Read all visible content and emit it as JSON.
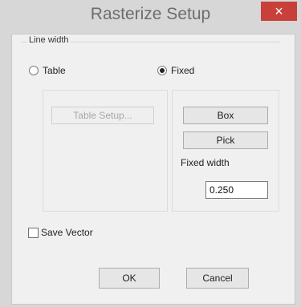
{
  "window": {
    "title": "Rasterize Setup",
    "close_glyph": "×"
  },
  "line_width": {
    "legend": "Line width",
    "options": [
      {
        "label": "Table",
        "checked": false
      },
      {
        "label": "Fixed",
        "checked": true
      }
    ]
  },
  "table_panel": {
    "table_setup_label": "Table Setup..."
  },
  "fixed_panel": {
    "box_label": "Box",
    "pick_label": "Pick",
    "fixed_width_label": "Fixed width",
    "fixed_width_value": "0.250"
  },
  "save_vector": {
    "label": "Save Vector",
    "checked": false
  },
  "buttons": {
    "ok_label": "OK",
    "cancel_label": "Cancel"
  }
}
